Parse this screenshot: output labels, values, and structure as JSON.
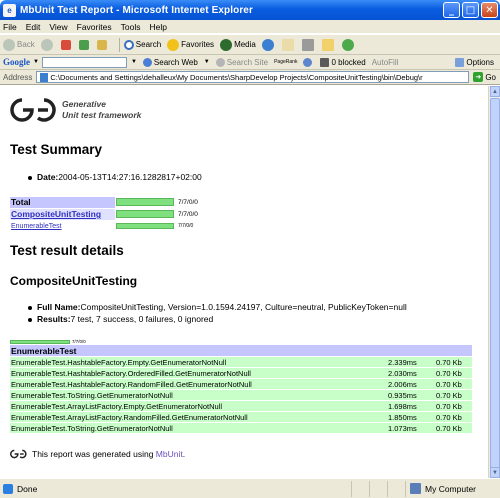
{
  "window": {
    "title": "MbUnit Test Report - Microsoft Internet Explorer",
    "minimize": "_",
    "maximize": "□",
    "close": "✕"
  },
  "menu": [
    "File",
    "Edit",
    "View",
    "Favorites",
    "Tools",
    "Help"
  ],
  "toolbar": {
    "back": "Back",
    "search": "Search",
    "favorites": "Favorites",
    "media": "Media"
  },
  "googlebar": {
    "logo": "Google",
    "search_web": "Search Web",
    "search_site": "Search Site",
    "pagerank": "PageRank",
    "blocked": "0 blocked",
    "autofill": "AutoFill",
    "options": "Options"
  },
  "address": {
    "label": "Address",
    "value": "C:\\Documents and Settings\\dehalleux\\My Documents\\SharpDevelop Projects\\CompositeUnitTesting\\bin\\Debug\\r",
    "go": "Go"
  },
  "report": {
    "logo_line1": "Generative",
    "logo_line2": "Unit test framework",
    "summary_title": "Test Summary",
    "date_label": "Date:",
    "date_value": "2004-05-13T14:27:16.1282817+02:00",
    "stats": [
      {
        "name": "Total",
        "value": "7/7/0/0",
        "fraction": 1.0
      },
      {
        "name": "CompositeUnitTesting",
        "value": "7/7/0/0",
        "fraction": 1.0
      },
      {
        "name": "EnumerableTest",
        "value": "7/7/0/0",
        "fraction": 1.0
      }
    ],
    "details_title": "Test result details",
    "fixture_title": "CompositeUnitTesting",
    "full_name_label": "Full Name:",
    "full_name_value": "CompositeUnitTesting, Version=1.0.1594.24197, Culture=neutral, PublicKeyToken=null",
    "results_label": "Results:",
    "results_value": "7 test, 7 success, 0 failures, 0 ignored",
    "mini_bar_label": "7/7/0/0",
    "table_header": "EnumerableTest",
    "rows": [
      {
        "name": "EnumerableTest.HashtableFactory.Empty.GetEnumeratorNotNull",
        "duration": "2.339ms",
        "memory": "0.70 Kb"
      },
      {
        "name": "EnumerableTest.HashtableFactory.OrderedFilled.GetEnumeratorNotNull",
        "duration": "2.030ms",
        "memory": "0.70 Kb"
      },
      {
        "name": "EnumerableTest.HashtableFactory.RandomFilled.GetEnumeratorNotNull",
        "duration": "2.006ms",
        "memory": "0.70 Kb"
      },
      {
        "name": "EnumerableTest.ToString.GetEnumeratorNotNull",
        "duration": "0.935ms",
        "memory": "0.70 Kb"
      },
      {
        "name": "EnumerableTest.ArrayListFactory.Empty.GetEnumeratorNotNull",
        "duration": "1.698ms",
        "memory": "0.70 Kb"
      },
      {
        "name": "EnumerableTest.ArrayListFactory.RandomFilled.GetEnumeratorNotNull",
        "duration": "1.850ms",
        "memory": "0.70 Kb"
      },
      {
        "name": "EnumerableTest.ToString.GetEnumeratorNotNull",
        "duration": "1.073ms",
        "memory": "0.70 Kb"
      }
    ],
    "footer_prefix": "This report was generated using ",
    "footer_link": "MbUnit",
    "footer_suffix": "."
  },
  "status": {
    "left": "Done",
    "zone": "My Computer"
  },
  "colors": {
    "pass_bar": "#7fe07f",
    "fixture_header": "#c6c6ff",
    "row_success": "#c8ffc8"
  }
}
